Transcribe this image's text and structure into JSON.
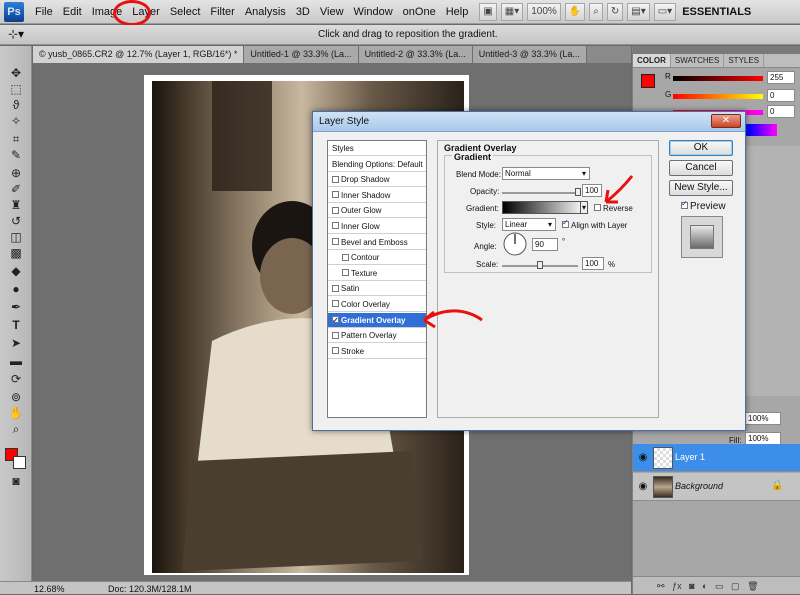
{
  "app": {
    "logo": "Ps"
  },
  "menubar": {
    "items": [
      "File",
      "Edit",
      "Image",
      "Layer",
      "Select",
      "Filter",
      "Analysis",
      "3D",
      "View",
      "Window",
      "onOne",
      "Help"
    ],
    "zoom": "100%",
    "workspace": "ESSENTIALS"
  },
  "options": {
    "hint": "Click and drag to reposition the gradient."
  },
  "tabs": [
    "© yusb_0865.CR2 @ 12.7% (Layer 1, RGB/16*) *",
    "Untitled-1 @ 33.3% (La...",
    "Untitled-2 @ 33.3% (La...",
    "Untitled-3 @ 33.3% (La..."
  ],
  "status": {
    "zoom": "12.68%",
    "doc": "Doc: 120.3M/128.1M"
  },
  "panels": {
    "color_tabs": [
      "COLOR",
      "SWATCHES",
      "STYLES"
    ],
    "color": {
      "r_label": "R",
      "r_value": "255",
      "g_label": "G",
      "g_value": "0",
      "b_value": "0",
      "fg_color": "#ff0000"
    },
    "layers": {
      "fill_label": "Fill:",
      "fill_value": "100%",
      "opacity_value": "100%",
      "rows": [
        {
          "name": "Layer 1",
          "selected": true
        },
        {
          "name": "Background",
          "selected": false
        }
      ]
    }
  },
  "dialog": {
    "title": "Layer Style",
    "styles": [
      {
        "label": "Styles",
        "checkbox": false,
        "checked": false,
        "indent": false,
        "active": false
      },
      {
        "label": "Blending Options: Default",
        "checkbox": false,
        "checked": false,
        "indent": false,
        "active": false
      },
      {
        "label": "Drop Shadow",
        "checkbox": true,
        "checked": false,
        "indent": false,
        "active": false
      },
      {
        "label": "Inner Shadow",
        "checkbox": true,
        "checked": false,
        "indent": false,
        "active": false
      },
      {
        "label": "Outer Glow",
        "checkbox": true,
        "checked": false,
        "indent": false,
        "active": false
      },
      {
        "label": "Inner Glow",
        "checkbox": true,
        "checked": false,
        "indent": false,
        "active": false
      },
      {
        "label": "Bevel and Emboss",
        "checkbox": true,
        "checked": false,
        "indent": false,
        "active": false
      },
      {
        "label": "Contour",
        "checkbox": true,
        "checked": false,
        "indent": true,
        "active": false
      },
      {
        "label": "Texture",
        "checkbox": true,
        "checked": false,
        "indent": true,
        "active": false
      },
      {
        "label": "Satin",
        "checkbox": true,
        "checked": false,
        "indent": false,
        "active": false
      },
      {
        "label": "Color Overlay",
        "checkbox": true,
        "checked": false,
        "indent": false,
        "active": false
      },
      {
        "label": "Gradient Overlay",
        "checkbox": true,
        "checked": true,
        "indent": false,
        "active": true
      },
      {
        "label": "Pattern Overlay",
        "checkbox": true,
        "checked": false,
        "indent": false,
        "active": false
      },
      {
        "label": "Stroke",
        "checkbox": true,
        "checked": false,
        "indent": false,
        "active": false
      }
    ],
    "section_title": "Gradient Overlay",
    "group_title": "Gradient",
    "blend_mode_label": "Blend Mode:",
    "blend_mode": "Normal",
    "opacity_label": "Opacity:",
    "opacity": "100",
    "opacity_fraction": 1.0,
    "gradient_label": "Gradient:",
    "reverse_label": "Reverse",
    "style_label": "Style:",
    "style": "Linear",
    "align_label": "Align with Layer",
    "angle_label": "Angle:",
    "angle": "90",
    "angle_unit": "°",
    "scale_label": "Scale:",
    "scale": "100",
    "scale_unit": "%",
    "scale_fraction": 0.5,
    "buttons": {
      "ok": "OK",
      "cancel": "Cancel",
      "new_style": "New Style...",
      "preview": "Preview"
    }
  }
}
